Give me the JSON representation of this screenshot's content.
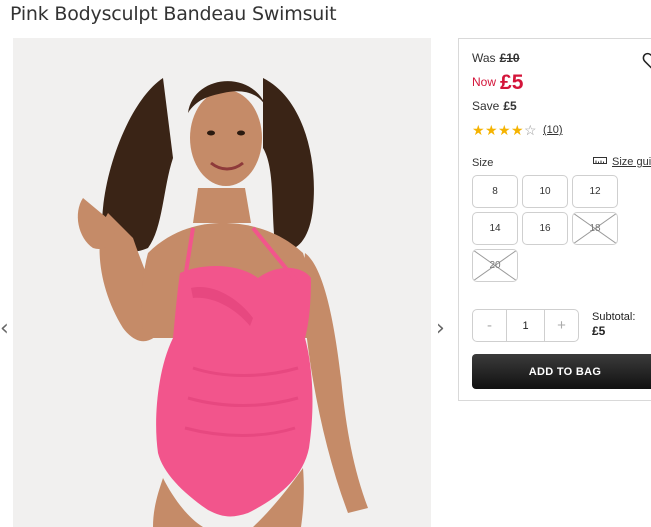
{
  "product": {
    "title": "Pink Bodysculpt Bandeau Swimsuit"
  },
  "gallery": {
    "prev_icon": "chevron-left-icon",
    "next_icon": "chevron-right-icon",
    "prev_glyph": "‹",
    "next_glyph": "›"
  },
  "pricing": {
    "was_label": "Was",
    "was_price": "£10",
    "now_label": "Now",
    "now_price": "£5",
    "save_label": "Save",
    "save_amount": "£5",
    "price_color": "#d4153a"
  },
  "rating": {
    "stars": 4,
    "max": 5,
    "count": "(10)",
    "star_color": "#f5b301"
  },
  "size": {
    "label": "Size",
    "guide_label": "Size gui",
    "options": [
      {
        "label": "8",
        "available": true
      },
      {
        "label": "10",
        "available": true
      },
      {
        "label": "12",
        "available": true
      },
      {
        "label": "14",
        "available": true
      },
      {
        "label": "16",
        "available": true
      },
      {
        "label": "18",
        "available": false
      },
      {
        "label": "20",
        "available": false
      }
    ]
  },
  "quantity": {
    "minus": "-",
    "value": "1",
    "plus": "+"
  },
  "subtotal": {
    "label": "Subtotal:",
    "value": "£5"
  },
  "actions": {
    "add_to_bag": "ADD TO BAG",
    "wishlist_icon": "heart-icon"
  }
}
